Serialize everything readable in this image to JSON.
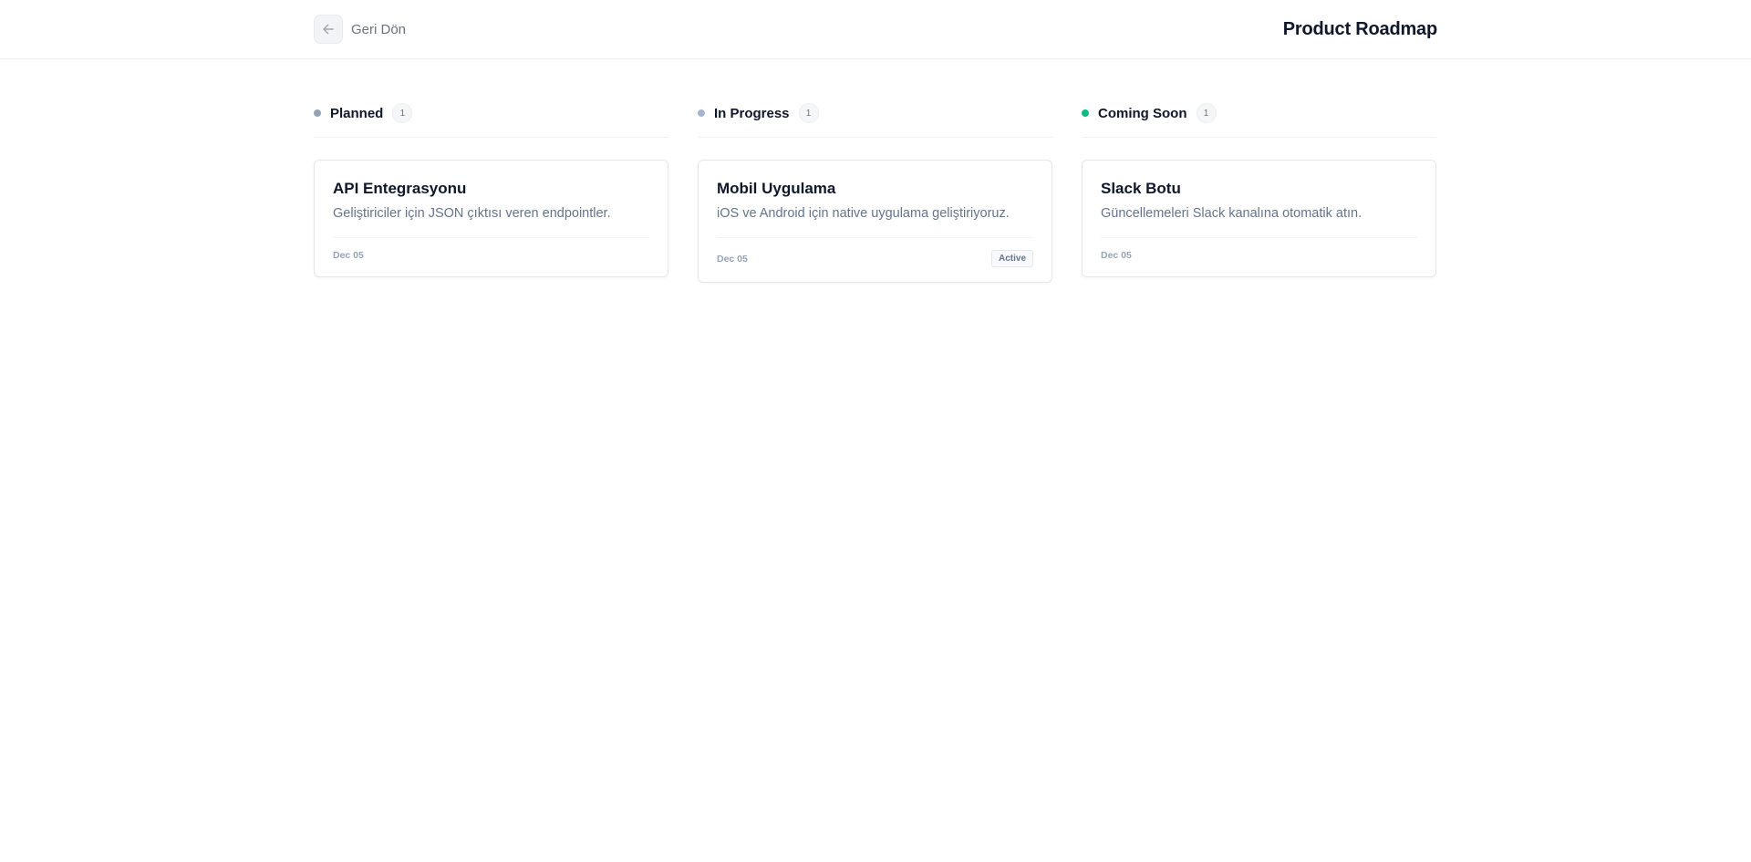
{
  "header": {
    "back_label": "Geri Dön",
    "title": "Product Roadmap"
  },
  "columns": [
    {
      "title": "Planned",
      "count": "1",
      "dot_color": "#94a3b8",
      "card": {
        "title": "API Entegrasyonu",
        "description": "Geliştiriciler için JSON çıktısı veren endpointler.",
        "date": "Dec 05",
        "badge": ""
      }
    },
    {
      "title": "In Progress",
      "count": "1",
      "dot_color": "#a5b4cf",
      "card": {
        "title": "Mobil Uygulama",
        "description": "iOS ve Android için native uygulama geliştiriyoruz.",
        "date": "Dec 05",
        "badge": "Active"
      }
    },
    {
      "title": "Coming Soon",
      "count": "1",
      "dot_color": "#10b981",
      "card": {
        "title": "Slack Botu",
        "description": "Güncellemeleri Slack kanalına otomatik atın.",
        "date": "Dec 05",
        "badge": ""
      }
    }
  ],
  "icons": {
    "back": "arrow-left-icon"
  }
}
